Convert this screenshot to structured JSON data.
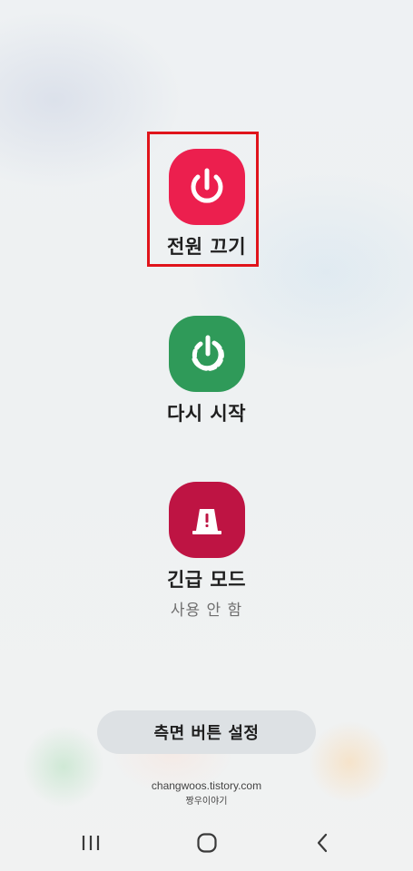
{
  "actions": [
    {
      "label": "전원 끄기",
      "icon": "power-icon",
      "color": "#ec1f4e"
    },
    {
      "label": "다시 시작",
      "icon": "restart-icon",
      "color": "#2f9a59"
    },
    {
      "label": "긴급 모드",
      "sublabel": "사용 안 함",
      "icon": "emergency-light-icon",
      "color": "#be1443"
    }
  ],
  "side_button": {
    "label": "측면 버튼 설정"
  },
  "watermark": {
    "url": "changwoos.tistory.com",
    "name": "짱우이야기"
  },
  "nav": {
    "recents_icon": "recents-icon",
    "home_icon": "home-icon",
    "back_icon": "back-icon"
  },
  "highlight_color": "#e0141b"
}
